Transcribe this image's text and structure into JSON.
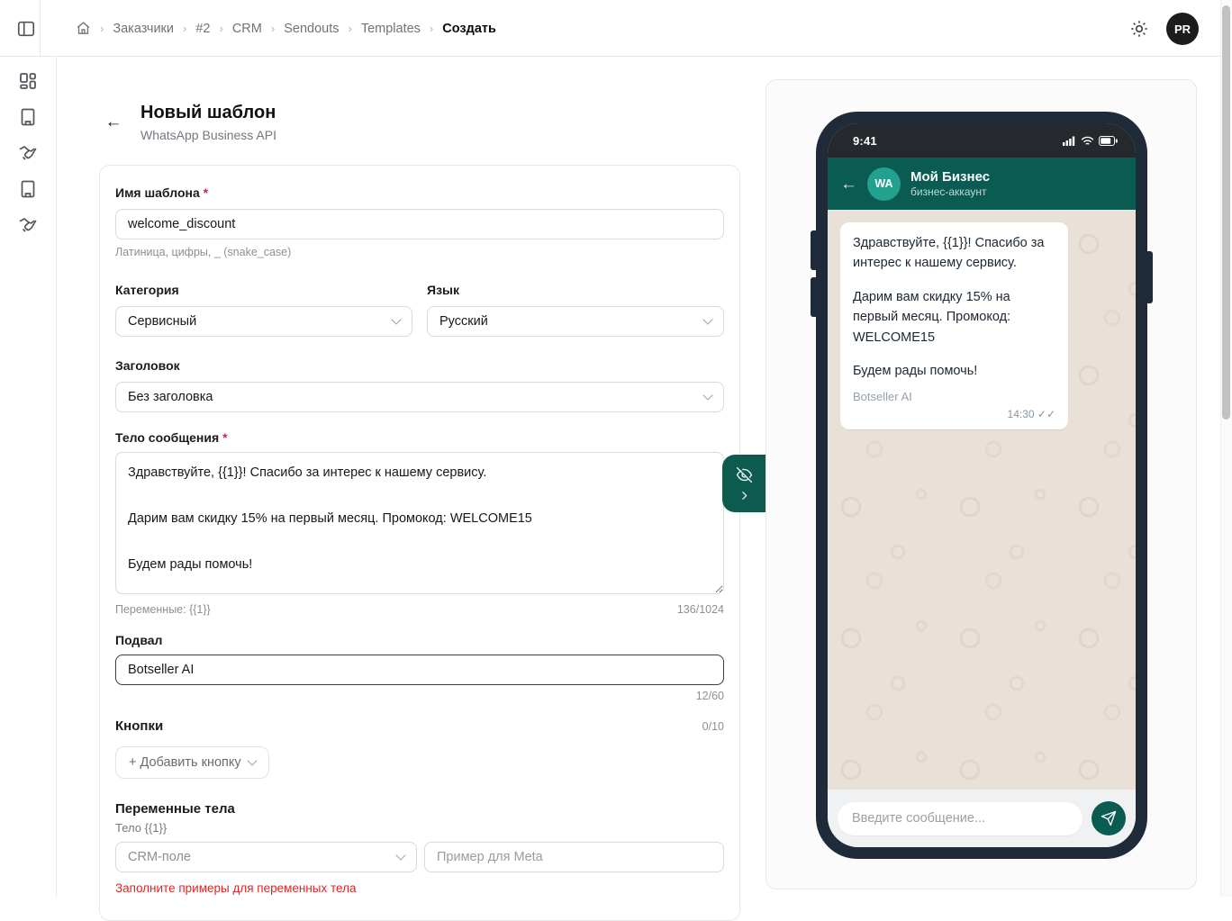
{
  "topbar": {
    "breadcrumb": {
      "items": [
        "Заказчики",
        "#2",
        "CRM",
        "Sendouts",
        "Templates",
        "Создать"
      ]
    },
    "avatar_initials": "PR"
  },
  "sidebar": {
    "icons": [
      "dashboard",
      "building",
      "handshake",
      "building",
      "handshake"
    ]
  },
  "page": {
    "title": "Новый шаблон",
    "subtitle": "WhatsApp Business API"
  },
  "form": {
    "name": {
      "label": "Имя шаблона",
      "required": "*",
      "value": "welcome_discount",
      "hint": "Латиница, цифры, _ (snake_case)"
    },
    "category": {
      "label": "Категория",
      "value": "Сервисный"
    },
    "language": {
      "label": "Язык",
      "value": "Русский"
    },
    "header": {
      "label": "Заголовок",
      "value": "Без заголовка"
    },
    "body": {
      "label": "Тело сообщения",
      "required": "*",
      "value": "Здравствуйте, {{1}}! Спасибо за интерес к нашему сервису.\n\nДарим вам скидку 15% на первый месяц. Промокод: WELCOME15\n\nБудем рады помочь!",
      "vars_hint": "Переменные: {{1}}",
      "counter": "136/1024"
    },
    "footer": {
      "label": "Подвал",
      "value": "Botseller AI",
      "counter": "12/60"
    },
    "buttons": {
      "label": "Кнопки",
      "counter": "0/10",
      "add_label": "+ Добавить кнопку"
    },
    "variables": {
      "title": "Переменные тела",
      "item_label": "Тело {{1}}",
      "field_placeholder": "CRM-поле",
      "example_placeholder": "Пример для Meta",
      "error": "Заполните примеры для переменных тела",
      "clipped_left": "CRM-поле",
      "clipped_right": "Пример для Meta"
    }
  },
  "preview": {
    "status": {
      "time": "9:41"
    },
    "chat_header": {
      "avatar": "WA",
      "title": "Мой Бизнес",
      "subtitle": "бизнес-аккаунт"
    },
    "message": {
      "p1": "Здравствуйте, {{1}}! Спасибо за интерес к нашему сервису.",
      "p2": "Дарим вам скидку 15% на первый месяц. Промокод: WELCOME15",
      "p3": "Будем рады помочь!",
      "footer": "Botseller AI",
      "time": "14:30",
      "ticks": "✓✓"
    },
    "composer": {
      "placeholder": "Введите сообщение..."
    }
  },
  "colors": {
    "accent_teal": "#0a5c52",
    "avatar_teal": "#23a08e",
    "phone_frame": "#1f2b38",
    "chat_bg": "#e9e0d7",
    "error_red": "#dc2626"
  }
}
